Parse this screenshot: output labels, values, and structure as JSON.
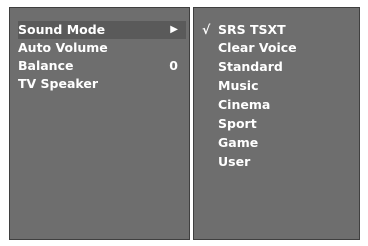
{
  "menu": {
    "items": [
      {
        "label": "Sound Mode",
        "value": "",
        "arrow": "▶"
      },
      {
        "label": "Auto Volume",
        "value": "",
        "arrow": ""
      },
      {
        "label": "Balance",
        "value": "0",
        "arrow": ""
      },
      {
        "label": "TV Speaker",
        "value": "",
        "arrow": ""
      }
    ],
    "selected_index": 0
  },
  "submenu": {
    "checkmark": "√",
    "options": [
      {
        "label": "SRS  TSXT",
        "checked": true
      },
      {
        "label": "Clear Voice",
        "checked": false
      },
      {
        "label": "Standard",
        "checked": false
      },
      {
        "label": "Music",
        "checked": false
      },
      {
        "label": "Cinema",
        "checked": false
      },
      {
        "label": "Sport",
        "checked": false
      },
      {
        "label": "Game",
        "checked": false
      },
      {
        "label": "User",
        "checked": false
      }
    ]
  },
  "colors": {
    "panel_bg": "#6e6e6e",
    "text": "#ffffff",
    "border": "#3f3f3f"
  }
}
